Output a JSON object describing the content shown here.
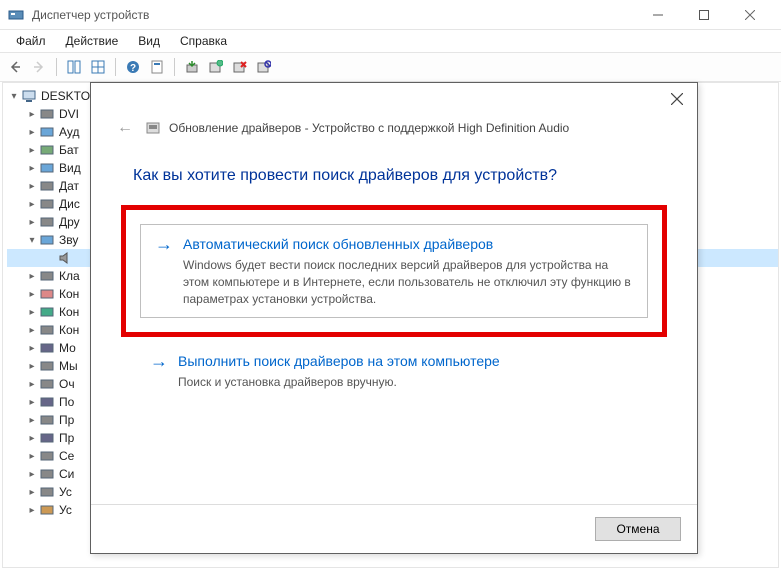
{
  "window": {
    "title": "Диспетчер устройств"
  },
  "menu": {
    "file": "Файл",
    "action": "Действие",
    "view": "Вид",
    "help": "Справка"
  },
  "tree": {
    "root": "DESKTO",
    "items": [
      {
        "label": "DVI"
      },
      {
        "label": "Ауд"
      },
      {
        "label": "Бат"
      },
      {
        "label": "Вид"
      },
      {
        "label": "Дат"
      },
      {
        "label": "Дис"
      },
      {
        "label": "Дру"
      },
      {
        "label": "Зву",
        "expanded": true,
        "child": ""
      },
      {
        "label": "Кла"
      },
      {
        "label": "Кон"
      },
      {
        "label": "Кон"
      },
      {
        "label": "Кон"
      },
      {
        "label": "Мо"
      },
      {
        "label": "Мы"
      },
      {
        "label": "Оч"
      },
      {
        "label": "По"
      },
      {
        "label": "Пр"
      },
      {
        "label": "Пр"
      },
      {
        "label": "Се"
      },
      {
        "label": "Си"
      },
      {
        "label": "Ус"
      },
      {
        "label": "Ус"
      }
    ]
  },
  "dialog": {
    "header": "Обновление драйверов - Устройство с поддержкой High Definition Audio",
    "question": "Как вы хотите провести поиск драйверов для устройств?",
    "option1": {
      "title": "Автоматический поиск обновленных драйверов",
      "desc": "Windows будет вести поиск последних версий драйверов для устройства на этом компьютере и в Интернете, если пользователь не отключил эту функцию в параметрах установки устройства."
    },
    "option2": {
      "title": "Выполнить поиск драйверов на этом компьютере",
      "desc": "Поиск и установка драйверов вручную."
    },
    "cancel": "Отмена"
  }
}
